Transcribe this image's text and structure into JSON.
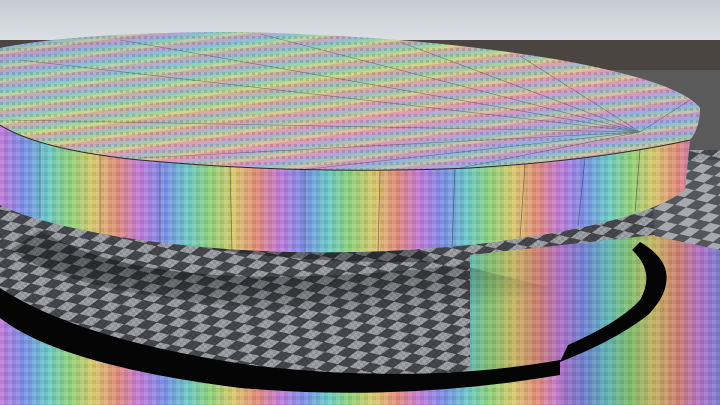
{
  "scene": {
    "colors": {
      "sky_top": "#c9cfd6",
      "sky_bottom": "#e4e7ea",
      "horizon_ground": "#4a4541",
      "floor_light": "#9a9da2",
      "floor_dark": "#3a3c40",
      "shadow": "#1c1d20",
      "black_band": "#050505"
    }
  }
}
